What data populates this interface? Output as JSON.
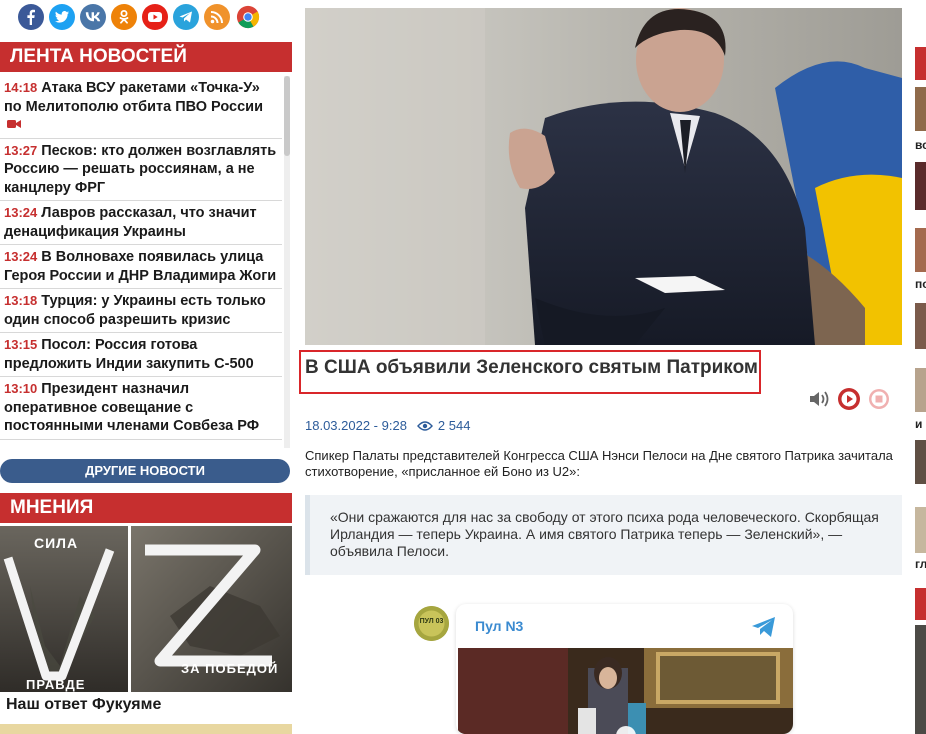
{
  "socials": [
    {
      "name": "facebook",
      "color": "#3b5998"
    },
    {
      "name": "twitter",
      "color": "#1da1f2"
    },
    {
      "name": "vk",
      "color": "#4a76a8"
    },
    {
      "name": "odnoklassniki",
      "color": "#ee8208"
    },
    {
      "name": "youtube",
      "color": "#e62117"
    },
    {
      "name": "telegram",
      "color": "#2aa3dc"
    },
    {
      "name": "rss",
      "color": "#f0922b"
    },
    {
      "name": "chrome",
      "color": "#ffffff"
    }
  ],
  "news_feed": {
    "title": "ЛЕНТА НОВОСТЕЙ",
    "items": [
      {
        "time": "14:18",
        "text": "Атака ВСУ ракетами «Точка-У» по Мелитополю отбита ПВО России",
        "video": true
      },
      {
        "time": "13:27",
        "text": "Песков: кто должен возглавлять Россию — решать россиянам, а не канцлеру ФРГ",
        "video": false
      },
      {
        "time": "13:24",
        "text": "Лавров рассказал, что значит денацификация Украины",
        "video": false
      },
      {
        "time": "13:24",
        "text": "В Волновахе появилась улица Героя России и ДНР Владимира Жоги",
        "video": false
      },
      {
        "time": "13:18",
        "text": "Турция: у Украины есть только один способ разрешить кризис",
        "video": false
      },
      {
        "time": "13:15",
        "text": "Посол: Россия готова предложить Индии закупить С-500",
        "video": false
      },
      {
        "time": "13:10",
        "text": "Президент назначил оперативное совещание с постоянными членами Совбеза РФ",
        "video": false
      }
    ],
    "more_label": "ДРУГИЕ НОВОСТИ"
  },
  "opinions": {
    "title": "МНЕНИЯ",
    "image_text": {
      "top": "СИЛА",
      "bottom_left": "ПРАВДЕ",
      "bottom_right": "ЗА ПОБЕДОЙ"
    },
    "caption": "Наш ответ Фукуяме"
  },
  "article": {
    "headline": "В США объявили Зеленского святым Патриком",
    "date": "18.03.2022 - 9:28",
    "views": "2 544",
    "lead": "Спикер Палаты представителей Конгресса США Нэнси Пелоси на Дне святого Патрика зачитала стихотворение, «присланное ей Боно из U2»:",
    "quote": "«Они сражаются для нас за свободу от этого психа рода человеческого. Скорбящая Ирландия — теперь Украина. А имя святого Патрика теперь — Зеленский», — объявила Пелоси."
  },
  "telegram_embed": {
    "channel": "Пул N3",
    "avatar_text": "ПУЛ 03"
  },
  "right_strip": {
    "fragments": [
      "вс",
      "по",
      "и",
      "гл"
    ]
  },
  "colors": {
    "accent_red": "#c62f2f",
    "headline_highlight": "#d9262a",
    "nav_blue": "#3a5c8c",
    "link_blue": "#2d5c9a",
    "telegram_blue": "#3a8ad0"
  }
}
